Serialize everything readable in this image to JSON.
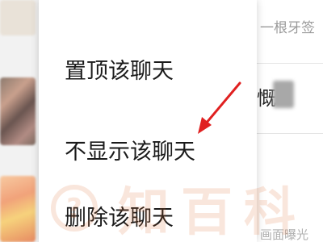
{
  "menu": {
    "items": [
      {
        "label": "置顶该聊天"
      },
      {
        "label": "不显示该聊天"
      },
      {
        "label": "删除该聊天"
      }
    ]
  },
  "background": {
    "preview_text": "一根牙签",
    "name_fragment": "慨",
    "bottom_fragment": "画面曝光"
  },
  "annotation": {
    "arrow_color": "#e02020",
    "icon": "red-arrow-icon"
  },
  "watermark": {
    "text": "知百科",
    "color": "#e06a2a",
    "icon": "question-badge-icon"
  }
}
